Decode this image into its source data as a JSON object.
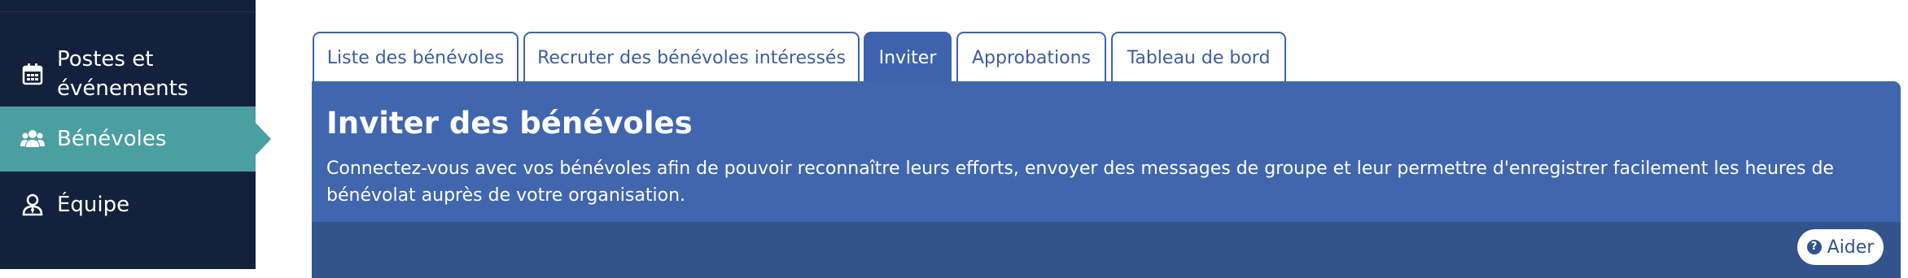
{
  "sidebar": {
    "items": [
      {
        "label": "Postes et\névénements",
        "icon": "calendar-icon"
      },
      {
        "label": "Bénévoles",
        "icon": "users-icon",
        "active": true
      },
      {
        "label": "Équipe",
        "icon": "user-tie-icon"
      }
    ]
  },
  "tabs": [
    {
      "label": "Liste des bénévoles"
    },
    {
      "label": "Recruter des bénévoles intéressés"
    },
    {
      "label": "Inviter",
      "active": true
    },
    {
      "label": "Approbations"
    },
    {
      "label": "Tableau de bord"
    }
  ],
  "panel": {
    "title": "Inviter des bénévoles",
    "description": "Connectez-vous avec vos bénévoles afin de pouvoir reconnaître leurs efforts, envoyer des messages de groupe et leur permettre d'enregistrer facilement les heures de bénévolat auprès de votre organisation."
  },
  "help": {
    "label": "Aider",
    "icon": "question-circle-icon"
  },
  "colors": {
    "sidebar_bg": "#14213d",
    "sidebar_active": "#4a9fa1",
    "accent": "#3e63ad",
    "panel_bg": "#4066ae",
    "panel_footer": "#32538c"
  }
}
